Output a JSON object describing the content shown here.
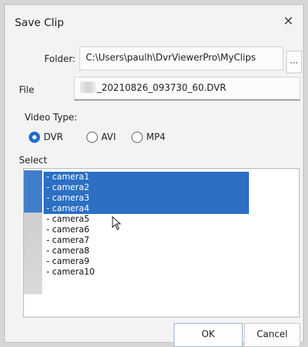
{
  "window": {
    "title": "Save Clip",
    "close_symbol": "✕"
  },
  "folder": {
    "label": "Folder:",
    "value": "C:\\Users\\paulh\\DvrViewerPro\\MyClips",
    "browse_label": "..."
  },
  "file": {
    "label": "File",
    "value": "_20210826_093730_60.DVR"
  },
  "video_type": {
    "label": "Video Type:",
    "options": [
      {
        "label": "DVR",
        "selected": true
      },
      {
        "label": "AVI",
        "selected": false
      },
      {
        "label": "MP4",
        "selected": false
      }
    ]
  },
  "select": {
    "label": "Select",
    "items": [
      {
        "label": "- camera1",
        "selected": true
      },
      {
        "label": "- camera2",
        "selected": true
      },
      {
        "label": "- camera3",
        "selected": true
      },
      {
        "label": "- camera4",
        "selected": true
      },
      {
        "label": "- camera5",
        "selected": false
      },
      {
        "label": "- camera6",
        "selected": false
      },
      {
        "label": "- camera7",
        "selected": false
      },
      {
        "label": "- camera8",
        "selected": false
      },
      {
        "label": "- camera9",
        "selected": false
      },
      {
        "label": "- camera10",
        "selected": false
      }
    ]
  },
  "buttons": {
    "ok": "OK",
    "cancel": "Cancel"
  },
  "colors": {
    "accent": "#2c6fc4",
    "background": "#f3f3f3"
  }
}
